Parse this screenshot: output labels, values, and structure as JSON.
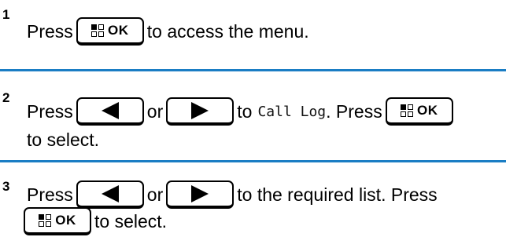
{
  "accent_color": "#1a7dc4",
  "keys": {
    "ok_label": "OK",
    "ok_icon": "menu-grid-icon",
    "left_icon": "left-arrow-icon",
    "right_icon": "right-arrow-icon"
  },
  "steps": [
    {
      "number": "1",
      "text_a": "Press",
      "text_b": "to access the menu."
    },
    {
      "number": "2",
      "text_a": "Press",
      "text_or": "or",
      "text_to": "to",
      "menu_item": "Call Log",
      "text_press": ". Press",
      "text_select": "to select."
    },
    {
      "number": "3",
      "text_a": "Press",
      "text_or": "or",
      "text_b": "to the required list. Press",
      "text_select": "to select."
    }
  ]
}
